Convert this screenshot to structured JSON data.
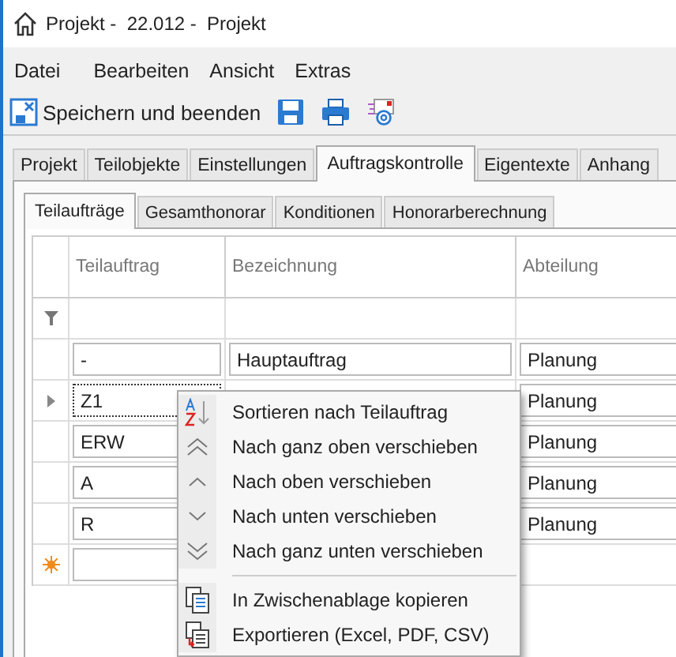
{
  "window": {
    "title": "Projekt -  22.012 -  Projekt"
  },
  "menu": [
    "Datei",
    "Bearbeiten",
    "Ansicht",
    "Extras"
  ],
  "toolbar": {
    "save_close": "Speichern und beenden"
  },
  "tabs": [
    {
      "label": "Projekt",
      "selected": false
    },
    {
      "label": "Teilobjekte",
      "selected": false
    },
    {
      "label": "Einstellungen",
      "selected": false
    },
    {
      "label": "Auftragskontrolle",
      "selected": true
    },
    {
      "label": "Eigentexte",
      "selected": false
    },
    {
      "label": "Anhang",
      "selected": false
    }
  ],
  "subtabs": [
    {
      "label": "Teilaufträge",
      "selected": true
    },
    {
      "label": "Gesamthonorar",
      "selected": false
    },
    {
      "label": "Konditionen",
      "selected": false
    },
    {
      "label": "Honorarberechnung",
      "selected": false
    }
  ],
  "table": {
    "columns": [
      "Teilauftrag",
      "Bezeichnung",
      "Abteilung"
    ],
    "rows": [
      {
        "teilauftrag": "-",
        "bezeichnung": "Hauptauftrag",
        "abteilung": "Planung",
        "current": false
      },
      {
        "teilauftrag": "Z1",
        "abteilung": "Planung",
        "current": true
      },
      {
        "teilauftrag": "ERW",
        "abteilung": "Planung",
        "current": false
      },
      {
        "teilauftrag": "A",
        "abteilung": "Planung",
        "current": false
      },
      {
        "teilauftrag": "R",
        "abteilung": "Planung",
        "current": false
      }
    ]
  },
  "context_menu": {
    "groups": [
      [
        "Sortieren nach Teilauftrag",
        "Nach ganz oben verschieben",
        "Nach oben verschieben",
        "Nach unten verschieben",
        "Nach ganz unten verschieben"
      ],
      [
        "In Zwischenablage kopieren",
        "Exportieren (Excel, PDF, CSV)"
      ]
    ]
  }
}
